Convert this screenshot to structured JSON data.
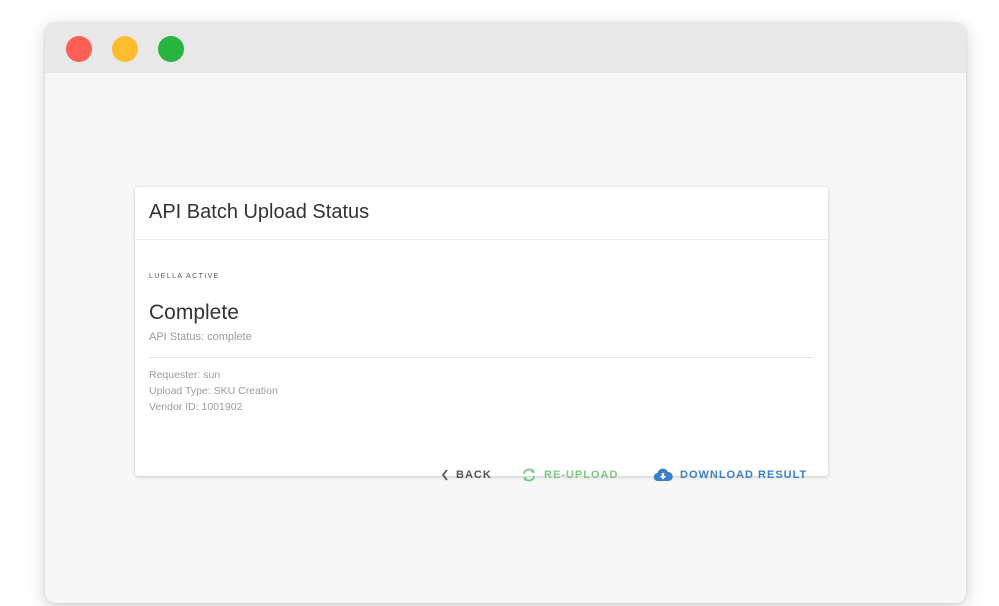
{
  "window": {
    "controls": [
      "close",
      "minimize",
      "maximize"
    ],
    "colors": {
      "close": "#fe5f57",
      "minimize": "#febc2e",
      "maximize": "#27b53f"
    }
  },
  "card": {
    "title": "API Batch Upload Status",
    "overline": "LUELLA ACTIVE",
    "status": "Complete",
    "api_status": "API Status: complete",
    "details": {
      "requester": "Requester: sun",
      "upload_type": "Upload Type: SKU Creation",
      "vendor_id": "Vendor ID: 1001902"
    },
    "actions": {
      "back": "BACK",
      "reupload": "RE-UPLOAD",
      "download": "DOWNLOAD RESULT"
    },
    "colors": {
      "reupload": "#7ec77e",
      "download": "#3a7fc9"
    },
    "icons": {
      "back": "chevron-left-icon",
      "reupload": "refresh-icon",
      "download": "cloud-download-icon"
    }
  }
}
